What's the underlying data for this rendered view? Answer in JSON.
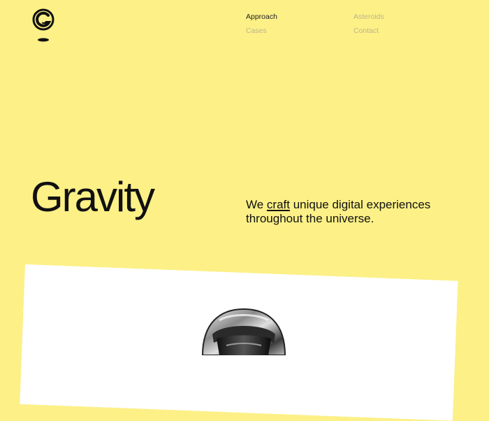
{
  "brand": {
    "logo_icon": "gravity-g-logo-icon"
  },
  "nav": {
    "approach": "Approach",
    "cases": "Cases",
    "asteroids": "Asteroids",
    "contact": "Contact"
  },
  "hero": {
    "title": "Gravity",
    "tagline_before": "We ",
    "tagline_link": "craft",
    "tagline_after": " unique digital experiences throughout the universe."
  },
  "image": {
    "icon": "astronaut-helmet-image"
  },
  "colors": {
    "background": "#fcf087",
    "text": "#111111",
    "muted_nav": "#bdb589",
    "card": "#ffffff"
  }
}
